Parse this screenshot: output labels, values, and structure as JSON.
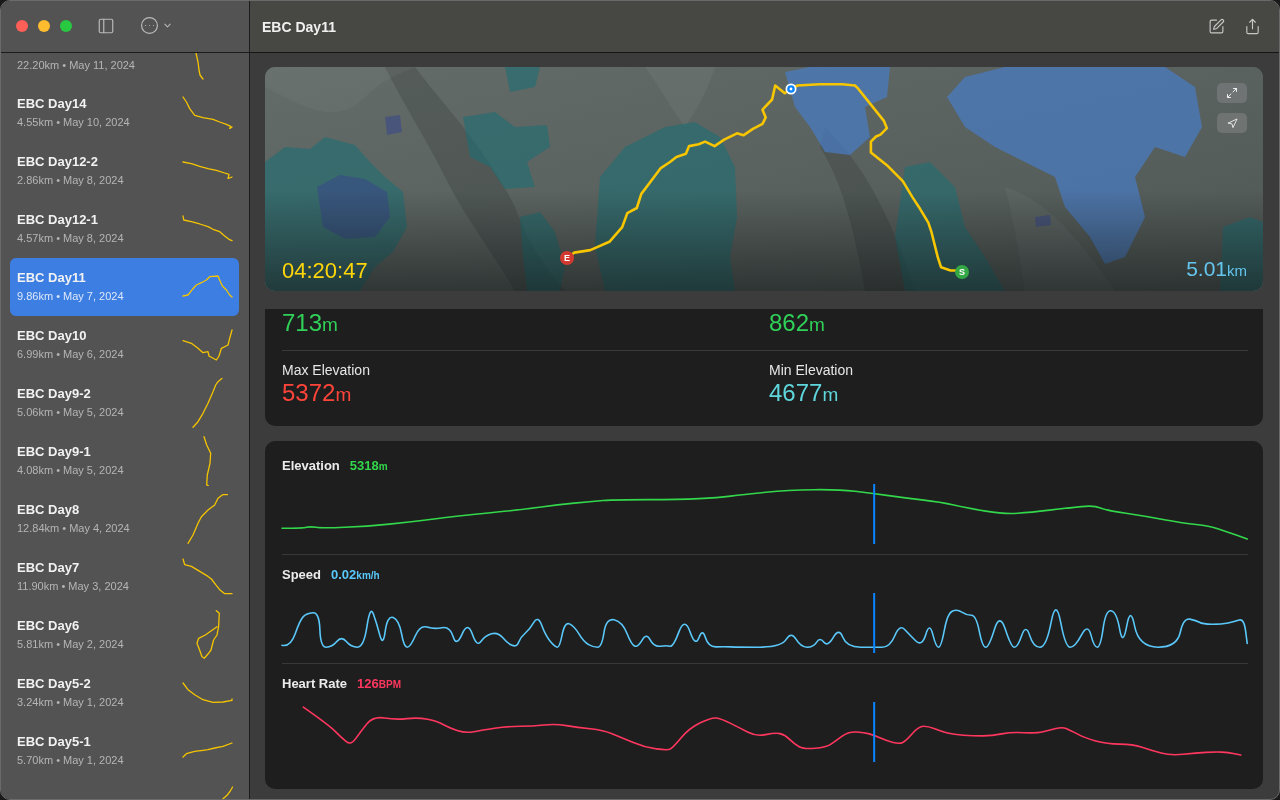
{
  "window": {
    "title": "EBC Day11"
  },
  "sidebar": {
    "items": [
      {
        "subtitle": "22.20km • May 11, 2024",
        "selected": false
      },
      {
        "title": "EBC Day14",
        "subtitle": "4.55km • May 10, 2024",
        "selected": false
      },
      {
        "title": "EBC Day12-2",
        "subtitle": "2.86km • May 8, 2024",
        "selected": false
      },
      {
        "title": "EBC Day12-1",
        "subtitle": "4.57km • May 8, 2024",
        "selected": false
      },
      {
        "title": "EBC Day11",
        "subtitle": "9.86km • May 7, 2024",
        "selected": true
      },
      {
        "title": "EBC Day10",
        "subtitle": "6.99km • May 6, 2024",
        "selected": false
      },
      {
        "title": "EBC Day9-2",
        "subtitle": "5.06km • May 5, 2024",
        "selected": false
      },
      {
        "title": "EBC Day9-1",
        "subtitle": "4.08km • May 5, 2024",
        "selected": false
      },
      {
        "title": "EBC Day8",
        "subtitle": "12.84km • May 4, 2024",
        "selected": false
      },
      {
        "title": "EBC Day7",
        "subtitle": "11.90km • May 3, 2024",
        "selected": false
      },
      {
        "title": "EBC Day6",
        "subtitle": "5.81km • May 2, 2024",
        "selected": false
      },
      {
        "title": "EBC Day5-2",
        "subtitle": "3.24km • May 1, 2024",
        "selected": false
      },
      {
        "title": "EBC Day5-1",
        "subtitle": "5.70km • May 1, 2024",
        "selected": false
      },
      {
        "selected": false
      }
    ]
  },
  "map": {
    "duration": "04:20:47",
    "distance": {
      "value": "5.01",
      "unit": "km"
    },
    "markers": [
      {
        "label": "E",
        "color": "#d23a30"
      },
      {
        "label": "S",
        "color": "#34a844"
      }
    ]
  },
  "stats": [
    {
      "value": "713",
      "unit": "m",
      "color": "#30d158"
    },
    {
      "value": "862",
      "unit": "m",
      "color": "#30d158"
    },
    {
      "label": "Max Elevation",
      "value": "5372",
      "unit": "m",
      "color": "#ff453a"
    },
    {
      "label": "Min Elevation",
      "value": "4677",
      "unit": "m",
      "color": "#5fd6dc"
    }
  ],
  "charts": {
    "scrubber": {
      "level": 0.613
    },
    "rows": [
      {
        "label": "Elevation",
        "value": "5318",
        "unit": "m",
        "color": "#32d74b"
      },
      {
        "label": "Speed",
        "value": "0.02",
        "unit": "km/h",
        "color": "#5ac8fa"
      },
      {
        "label": "Heart Rate",
        "value": "126",
        "unit": "BPM",
        "color": "#ff375f"
      }
    ]
  }
}
